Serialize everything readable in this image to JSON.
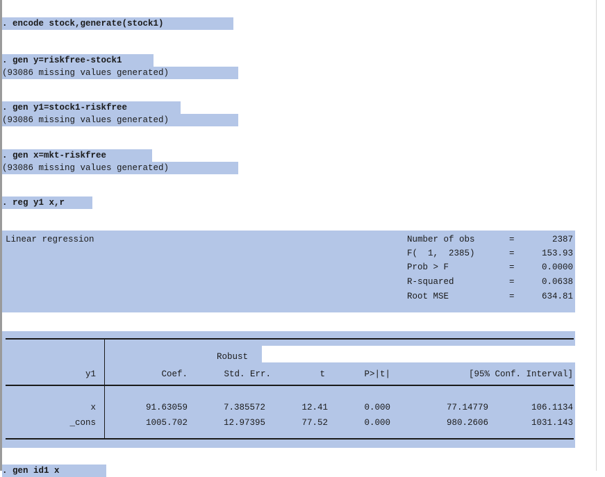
{
  "commands": [
    {
      "cmd": ". encode stock,generate(stock1)",
      "out": ""
    },
    {
      "cmd": ". gen y=riskfree-stock1",
      "out": "(93086 missing values generated)"
    },
    {
      "cmd": ". gen y1=stock1-riskfree",
      "out": "(93086 missing values generated)"
    },
    {
      "cmd": ". gen x=mkt-riskfree",
      "out": "(93086 missing values generated)"
    },
    {
      "cmd": ". reg y1 x,r",
      "out": ""
    }
  ],
  "regression": {
    "title": "Linear regression",
    "stats": [
      {
        "label": "Number of obs",
        "eq": "=",
        "value": "2387"
      },
      {
        "label": "F(  1,  2385)",
        "eq": "=",
        "value": "153.93"
      },
      {
        "label": "Prob > F",
        "eq": "=",
        "value": "0.0000"
      },
      {
        "label": "R-squared",
        "eq": "=",
        "value": "0.0638"
      },
      {
        "label": "Root MSE",
        "eq": "=",
        "value": "634.81"
      }
    ],
    "header_robust": "Robust",
    "columns": {
      "depvar": "y1",
      "coef": "Coef.",
      "se": "Std. Err.",
      "t": "t",
      "p": "P>|t|",
      "ci": "[95% Conf. Interval]"
    },
    "rows": [
      {
        "var": "x",
        "coef": "91.63059",
        "se": "7.385572",
        "t": "12.41",
        "p": "0.000",
        "lo": "77.14779",
        "hi": "106.1134"
      },
      {
        "var": "_cons",
        "coef": "1005.702",
        "se": "12.97395",
        "t": "77.52",
        "p": "0.000",
        "lo": "980.2606",
        "hi": "1031.143"
      }
    ]
  },
  "trailing_cmd": ". gen id1 x"
}
